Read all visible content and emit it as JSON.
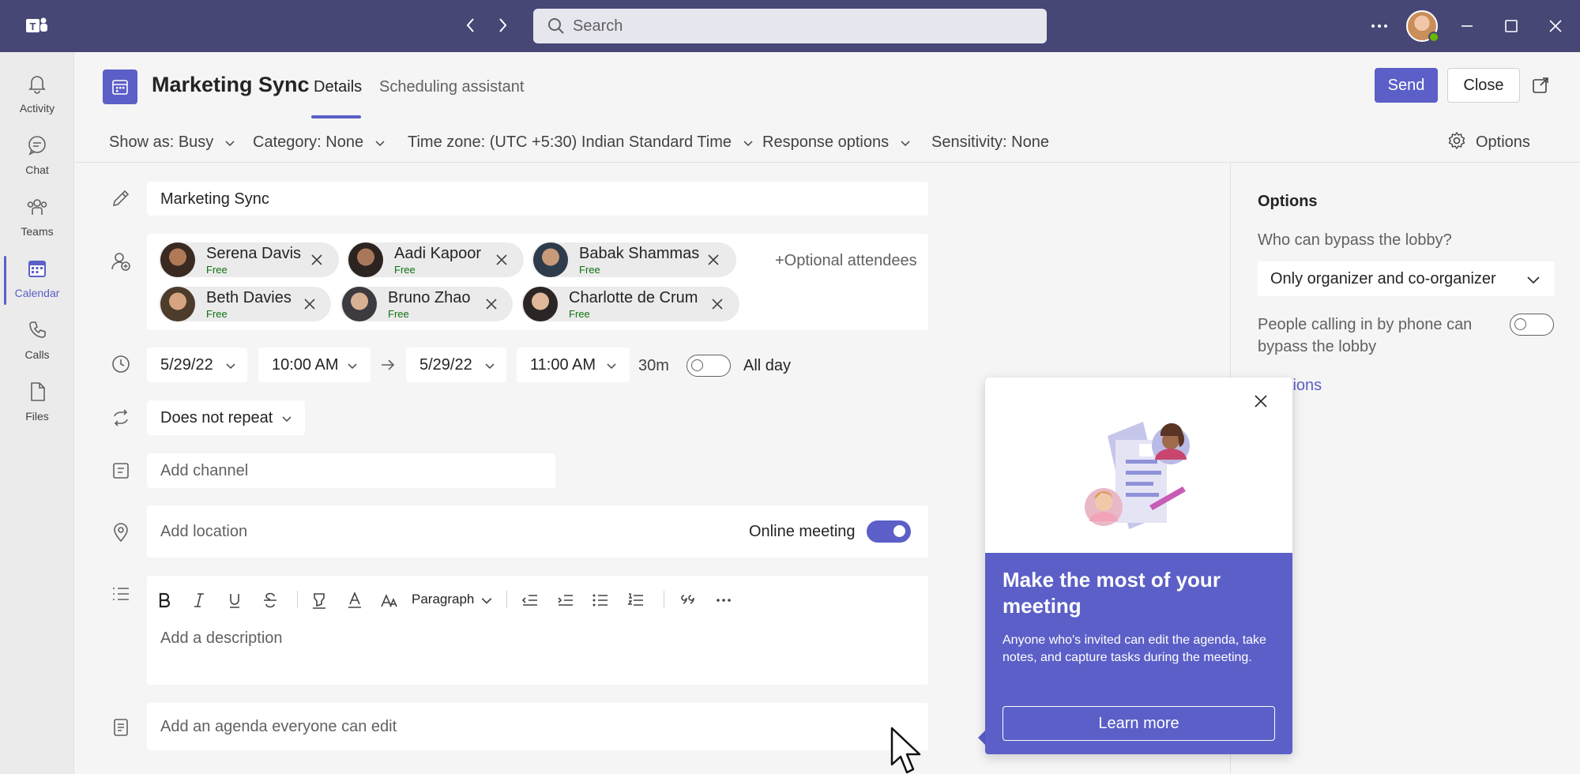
{
  "titlebar": {
    "search_placeholder": "Search"
  },
  "rail": {
    "items": [
      {
        "label": "Activity",
        "icon": "bell-icon"
      },
      {
        "label": "Chat",
        "icon": "chat-icon"
      },
      {
        "label": "Teams",
        "icon": "teams-icon"
      },
      {
        "label": "Calendar",
        "icon": "calendar-icon",
        "active": true
      },
      {
        "label": "Calls",
        "icon": "phone-icon"
      },
      {
        "label": "Files",
        "icon": "file-icon"
      }
    ]
  },
  "header": {
    "title": "Marketing Sync",
    "tabs": [
      {
        "label": "Details",
        "active": true
      },
      {
        "label": "Scheduling assistant",
        "active": false
      }
    ],
    "send_label": "Send",
    "close_label": "Close"
  },
  "optbar": {
    "show_as": "Show as: Busy",
    "category": "Category: None",
    "time_zone": "Time zone: (UTC +5:30) Indian Standard Time",
    "response": "Response options",
    "sensitivity": "Sensitivity: None",
    "options_label": "Options"
  },
  "form": {
    "title_value": "Marketing Sync",
    "attendees": [
      {
        "name": "Serena Davis",
        "status": "Free"
      },
      {
        "name": "Aadi Kapoor",
        "status": "Free"
      },
      {
        "name": "Babak Shammas",
        "status": "Free"
      },
      {
        "name": "Beth Davies",
        "status": "Free"
      },
      {
        "name": "Bruno Zhao",
        "status": "Free"
      },
      {
        "name": "Charlotte de Crum",
        "status": "Free"
      }
    ],
    "optional_attendees": "+Optional attendees",
    "start_date": "5/29/22",
    "start_time": "10:00 AM",
    "end_date": "5/29/22",
    "end_time": "11:00 AM",
    "duration": "30m",
    "all_day_label": "All day",
    "all_day_on": false,
    "repeat": "Does not repeat",
    "channel_placeholder": "Add channel",
    "location_placeholder": "Add location",
    "online_meeting_label": "Online meeting",
    "online_meeting_on": true,
    "paragraph_label": "Paragraph",
    "description_placeholder": "Add a description",
    "agenda_placeholder": "Add an agenda everyone can edit"
  },
  "options_panel": {
    "title": "Options",
    "lobby_question": "Who can bypass the lobby?",
    "lobby_value": "Only organizer and co-organizer",
    "phone_bypass": "People calling in by  phone can bypass the lobby",
    "phone_bypass_on": false,
    "more_options": "e options"
  },
  "popup": {
    "heading": "Make the most of your meeting",
    "body": "Anyone who's invited can edit the agenda, take notes, and capture tasks during the meeting.",
    "button": "Learn more"
  },
  "colors": {
    "titlebar": "#464775",
    "accent": "#5b5fc7",
    "free_status": "#0e700e"
  }
}
